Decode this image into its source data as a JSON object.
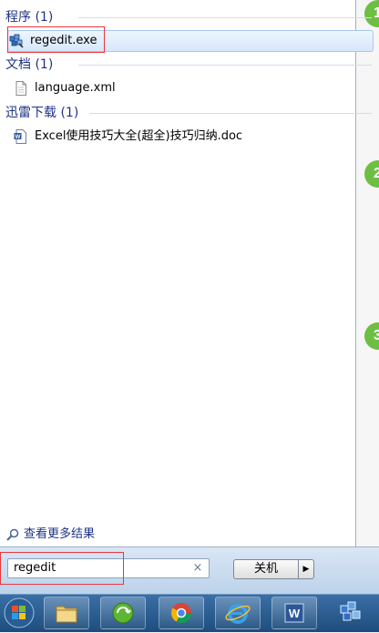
{
  "groups": {
    "programs": {
      "header": "程序 (1)",
      "items": [
        {
          "label": "regedit.exe",
          "icon": "registry-editor-icon"
        }
      ]
    },
    "documents": {
      "header": "文档 (1)",
      "items": [
        {
          "label": "language.xml",
          "icon": "document-icon"
        }
      ]
    },
    "thunder_downloads": {
      "header": "迅雷下载 (1)",
      "items": [
        {
          "label": "Excel使用技巧大全(超全)技巧归纳.doc",
          "icon": "word-document-icon"
        }
      ]
    }
  },
  "see_more": {
    "label": "查看更多结果"
  },
  "search": {
    "value": "regedit",
    "clear": "×"
  },
  "shutdown": {
    "label": "关机",
    "arrow": "▶"
  },
  "steps": [
    "1",
    "2",
    "3"
  ],
  "colors": {
    "highlight_red": "#e8383d",
    "step_green": "#6cbf43",
    "header_blue": "#1e3287"
  }
}
